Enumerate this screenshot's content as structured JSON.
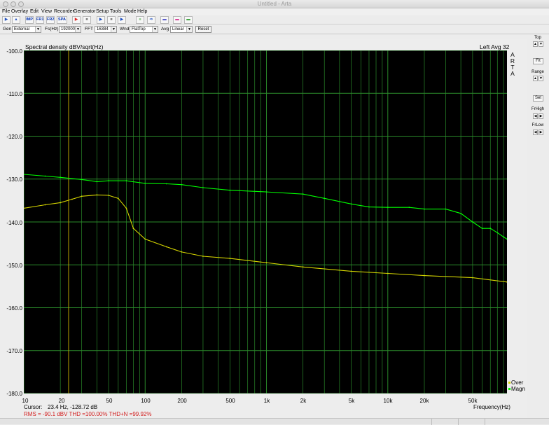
{
  "window": {
    "title": "Untitled - Arta"
  },
  "menu": [
    "File",
    "Overlay",
    "Edit",
    "View",
    "Recorder",
    "Generator",
    "Setup",
    "Tools",
    "Mode",
    "Help"
  ],
  "toolbar": {
    "imp": "IMP",
    "fr1": "FR1",
    "fr2": "FR2",
    "spa": "SPA"
  },
  "settings": {
    "gen_label": "Gen",
    "gen_value": "External",
    "fs_label": "Fs(Hz)",
    "fs_value": "192000",
    "fft_label": "FFT",
    "fft_value": "16384",
    "wnd_label": "Wnd",
    "wnd_value": "FlatTop",
    "avg_label": "Avg",
    "avg_value": "Linear",
    "reset_label": "Reset"
  },
  "right_panel": {
    "top": "Top",
    "fit": "Fit",
    "range": "Range",
    "set": "Set",
    "frhigh": "FrHigh",
    "frlow": "FrLow"
  },
  "plot": {
    "title": "Spectral density dBV/sqrt(Hz)",
    "right_title": "Left  Avg 32",
    "arta": [
      "A",
      "R",
      "T",
      "A"
    ],
    "y_ticks": [
      "-100.0",
      "-110.0",
      "-120.0",
      "-130.0",
      "-140.0",
      "-150.0",
      "-160.0",
      "-170.0",
      "-180.0"
    ],
    "x_ticks": [
      "10",
      "20",
      "50",
      "100",
      "200",
      "500",
      "1k",
      "2k",
      "5k",
      "10k",
      "20k",
      "50k"
    ],
    "x_label": "Frequency(Hz)",
    "legend": [
      {
        "name": "Over",
        "color": "#d4d400"
      },
      {
        "name": "Magn",
        "color": "#00ff00"
      }
    ],
    "cursor_label": "Cursor:",
    "cursor_value": "23.4 Hz, -128.72 dB",
    "rms_line": "RMS =  -90.1 dBV    THD =100.00%    THD+N =99.92%"
  },
  "colors": {
    "background": "#000000",
    "grid": "#2a8a2a",
    "magn": "#00ff00",
    "over": "#d4d400",
    "cursor": "#b8a000"
  },
  "chart_data": {
    "type": "line",
    "title": "Spectral density dBV/sqrt(Hz)",
    "xlabel": "Frequency(Hz)",
    "ylabel": "",
    "x_scale": "log",
    "xlim": [
      10,
      96000
    ],
    "ylim": [
      -180,
      -100
    ],
    "grid": true,
    "legend_position": "bottom-right",
    "cursor_x": 23.4,
    "series": [
      {
        "name": "Magn",
        "x": [
          10,
          15,
          20,
          30,
          40,
          50,
          70,
          100,
          150,
          200,
          300,
          500,
          1000,
          2000,
          3000,
          5000,
          7000,
          10000,
          15000,
          20000,
          30000,
          40000,
          50000,
          60000,
          70000,
          80000,
          90000,
          96000
        ],
        "y": [
          -128.9,
          -129.3,
          -129.6,
          -130.1,
          -130.6,
          -130.4,
          -130.4,
          -131.0,
          -131.1,
          -131.3,
          -132.0,
          -132.6,
          -133.0,
          -133.5,
          -134.5,
          -135.8,
          -136.5,
          -136.6,
          -136.6,
          -137.0,
          -137.0,
          -138.0,
          -140.0,
          -141.5,
          -141.5,
          -142.5,
          -143.5,
          -144.0
        ]
      },
      {
        "name": "Over",
        "x": [
          10,
          15,
          20,
          25,
          30,
          40,
          50,
          60,
          70,
          80,
          100,
          150,
          200,
          300,
          500,
          1000,
          2000,
          5000,
          10000,
          20000,
          50000,
          96000
        ],
        "y": [
          -136.8,
          -136.0,
          -135.5,
          -134.7,
          -134.0,
          -133.7,
          -133.8,
          -134.5,
          -136.8,
          -141.5,
          -144.0,
          -145.8,
          -147.0,
          -148.0,
          -148.5,
          -149.5,
          -150.5,
          -151.5,
          -152.0,
          -152.5,
          -153.0,
          -154.0
        ]
      }
    ]
  }
}
